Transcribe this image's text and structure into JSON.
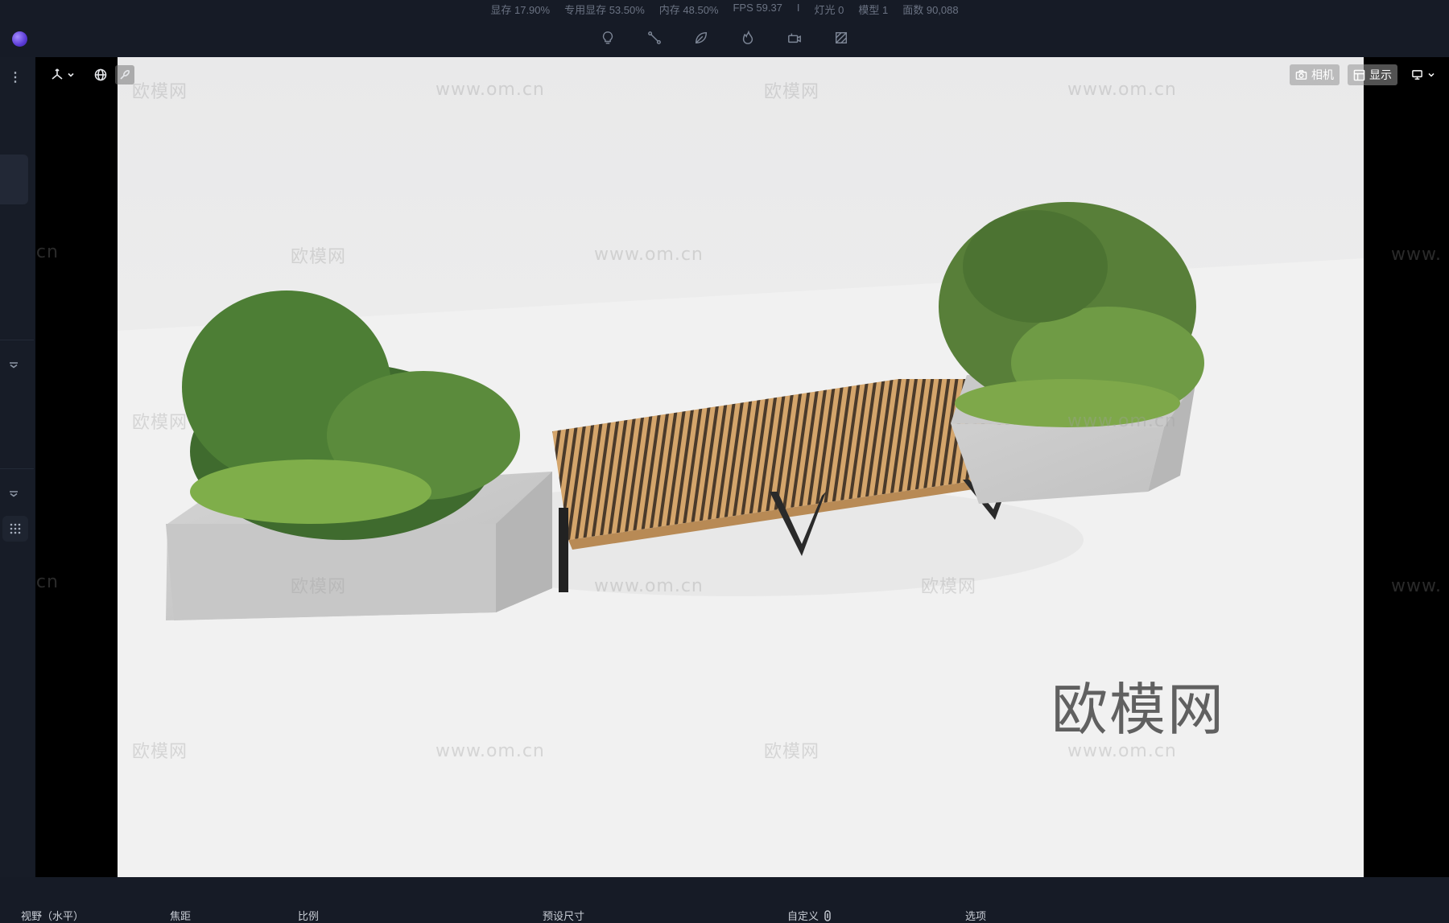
{
  "stats": {
    "vram": "显存 17.90%",
    "dedicated_vram": "专用显存 53.50%",
    "memory": "内存 48.50%",
    "fps": "FPS 59.37",
    "separator": "I",
    "lights": "灯光 0",
    "models": "模型 1",
    "faces": "面数 90,088"
  },
  "toolbar": {
    "tools": [
      "light-bulb-icon",
      "path-nodes-icon",
      "leaf-icon",
      "fire-icon",
      "video-camera-icon",
      "material-icon"
    ]
  },
  "viewport": {
    "camera_label": "相机",
    "display_label": "显示",
    "watermarks": {
      "brand": "欧模网",
      "url": "www.om.cn",
      "url_partial_left": "om.cn",
      "url_partial_right": "www.",
      "big_brand": "欧模网"
    }
  },
  "bottom_panel": {
    "fov_label": "视野（水平）",
    "focal_label": "焦距",
    "ratio_label": "比例",
    "preset_size_label": "预设尺寸",
    "custom_label": "自定义",
    "options_label": "选项"
  },
  "colors": {
    "app_bg": "#161b26",
    "viewport_bg": "#000000",
    "scene_bg": "#eeeeee",
    "accent": "#7b5cff"
  }
}
